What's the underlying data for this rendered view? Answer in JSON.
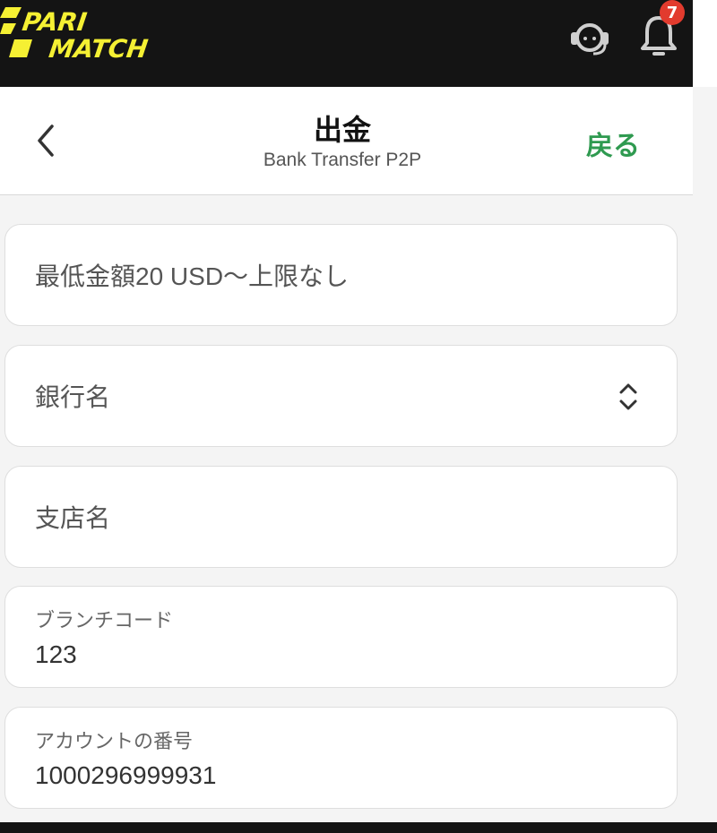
{
  "brand": {
    "logo_line1": "PARI",
    "logo_line2": "MATCH",
    "accent_color": "#f5f033",
    "topbar_color": "#141414"
  },
  "topbar": {
    "support_icon": "headset-icon",
    "notification_icon": "bell-icon",
    "notification_count": "7",
    "badge_color": "#e23b2e"
  },
  "header": {
    "title": "出金",
    "subtitle": "Bank Transfer P2P",
    "back_link": "戻る",
    "back_link_color": "#2f9a50"
  },
  "form": {
    "amount_placeholder": "最低金額20 USD〜上限なし",
    "bank_name_placeholder": "銀行名",
    "branch_name_placeholder": "支店名",
    "branch_code_label": "ブランチコード",
    "branch_code_value": "123",
    "account_number_label": "アカウントの番号",
    "account_number_value": "1000296999931"
  }
}
